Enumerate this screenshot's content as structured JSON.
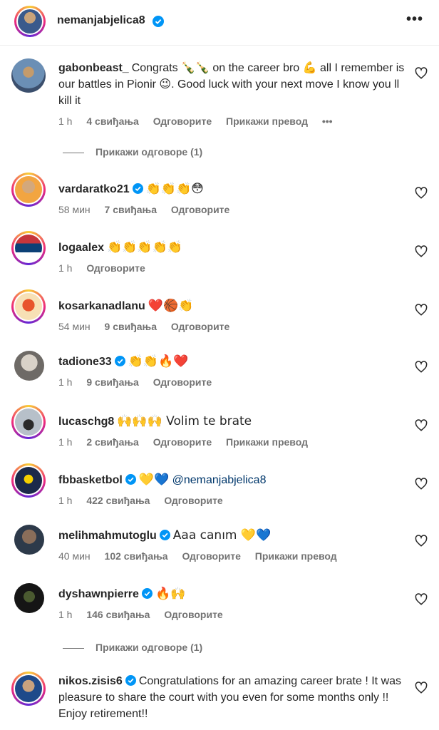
{
  "header": {
    "username": "nemanjabjelica8",
    "more": "•••"
  },
  "comments": [
    {
      "username": "gabonbeast_",
      "verified": false,
      "text": "Congrats 🍾🍾 on the career bro 💪 all I remember is our battles in Pionir 😉. Good luck with your next move I know you ll kill it",
      "time": "1 h",
      "likes": "4 свиђања",
      "reply": "Одговорите",
      "translate": "Прикажи превод",
      "more": "•••",
      "view_replies": "Прикажи одговоре (1)"
    },
    {
      "username": "vardaratko21",
      "verified": true,
      "text": "👏👏👏😳",
      "time": "58 мин",
      "likes": "7 свиђања",
      "reply": "Одговорите"
    },
    {
      "username": "logaalex",
      "verified": false,
      "text": "👏👏👏👏👏",
      "time": "1 h",
      "reply": "Одговорите"
    },
    {
      "username": "kosarkanadlanu",
      "verified": false,
      "text": "❤️🏀👏",
      "time": "54 мин",
      "likes": "9 свиђања",
      "reply": "Одговорите"
    },
    {
      "username": "tadione33",
      "verified": true,
      "text": "👏👏🔥❤️",
      "time": "1 h",
      "likes": "9 свиђања",
      "reply": "Одговорите"
    },
    {
      "username": "lucaschg8",
      "verified": false,
      "text": "🙌🙌🙌 Volim te brate",
      "time": "1 h",
      "likes": "2 свиђања",
      "reply": "Одговорите",
      "translate": "Прикажи превод"
    },
    {
      "username": "fbbasketbol",
      "verified": true,
      "text": "💛💙",
      "mention": "@nemanjabjelica8",
      "time": "1 h",
      "likes": "422 свиђања",
      "reply": "Одговорите"
    },
    {
      "username": "melihmahmutoglu",
      "verified": true,
      "text": "Aaa canım 💛💙",
      "time": "40 мин",
      "likes": "102 свиђања",
      "reply": "Одговорите",
      "translate": "Прикажи превод"
    },
    {
      "username": "dyshawnpierre",
      "verified": true,
      "text": "🔥🙌",
      "time": "1 h",
      "likes": "146 свиђања",
      "reply": "Одговорите",
      "view_replies": "Прикажи одговоре (1)"
    },
    {
      "username": "nikos.zisis6",
      "verified": true,
      "text": "Congratulations for an amazing career brate ! It was pleasure to share the court with you even for some months only !! Enjoy retirement!!"
    }
  ],
  "colors": {
    "verified": "#0095f6",
    "meta": "#737373",
    "text": "#262626",
    "mention": "#00376b"
  },
  "icons": {
    "heart": "heart-outline-icon",
    "verified": "verified-badge-icon",
    "more": "more-dots-icon"
  }
}
